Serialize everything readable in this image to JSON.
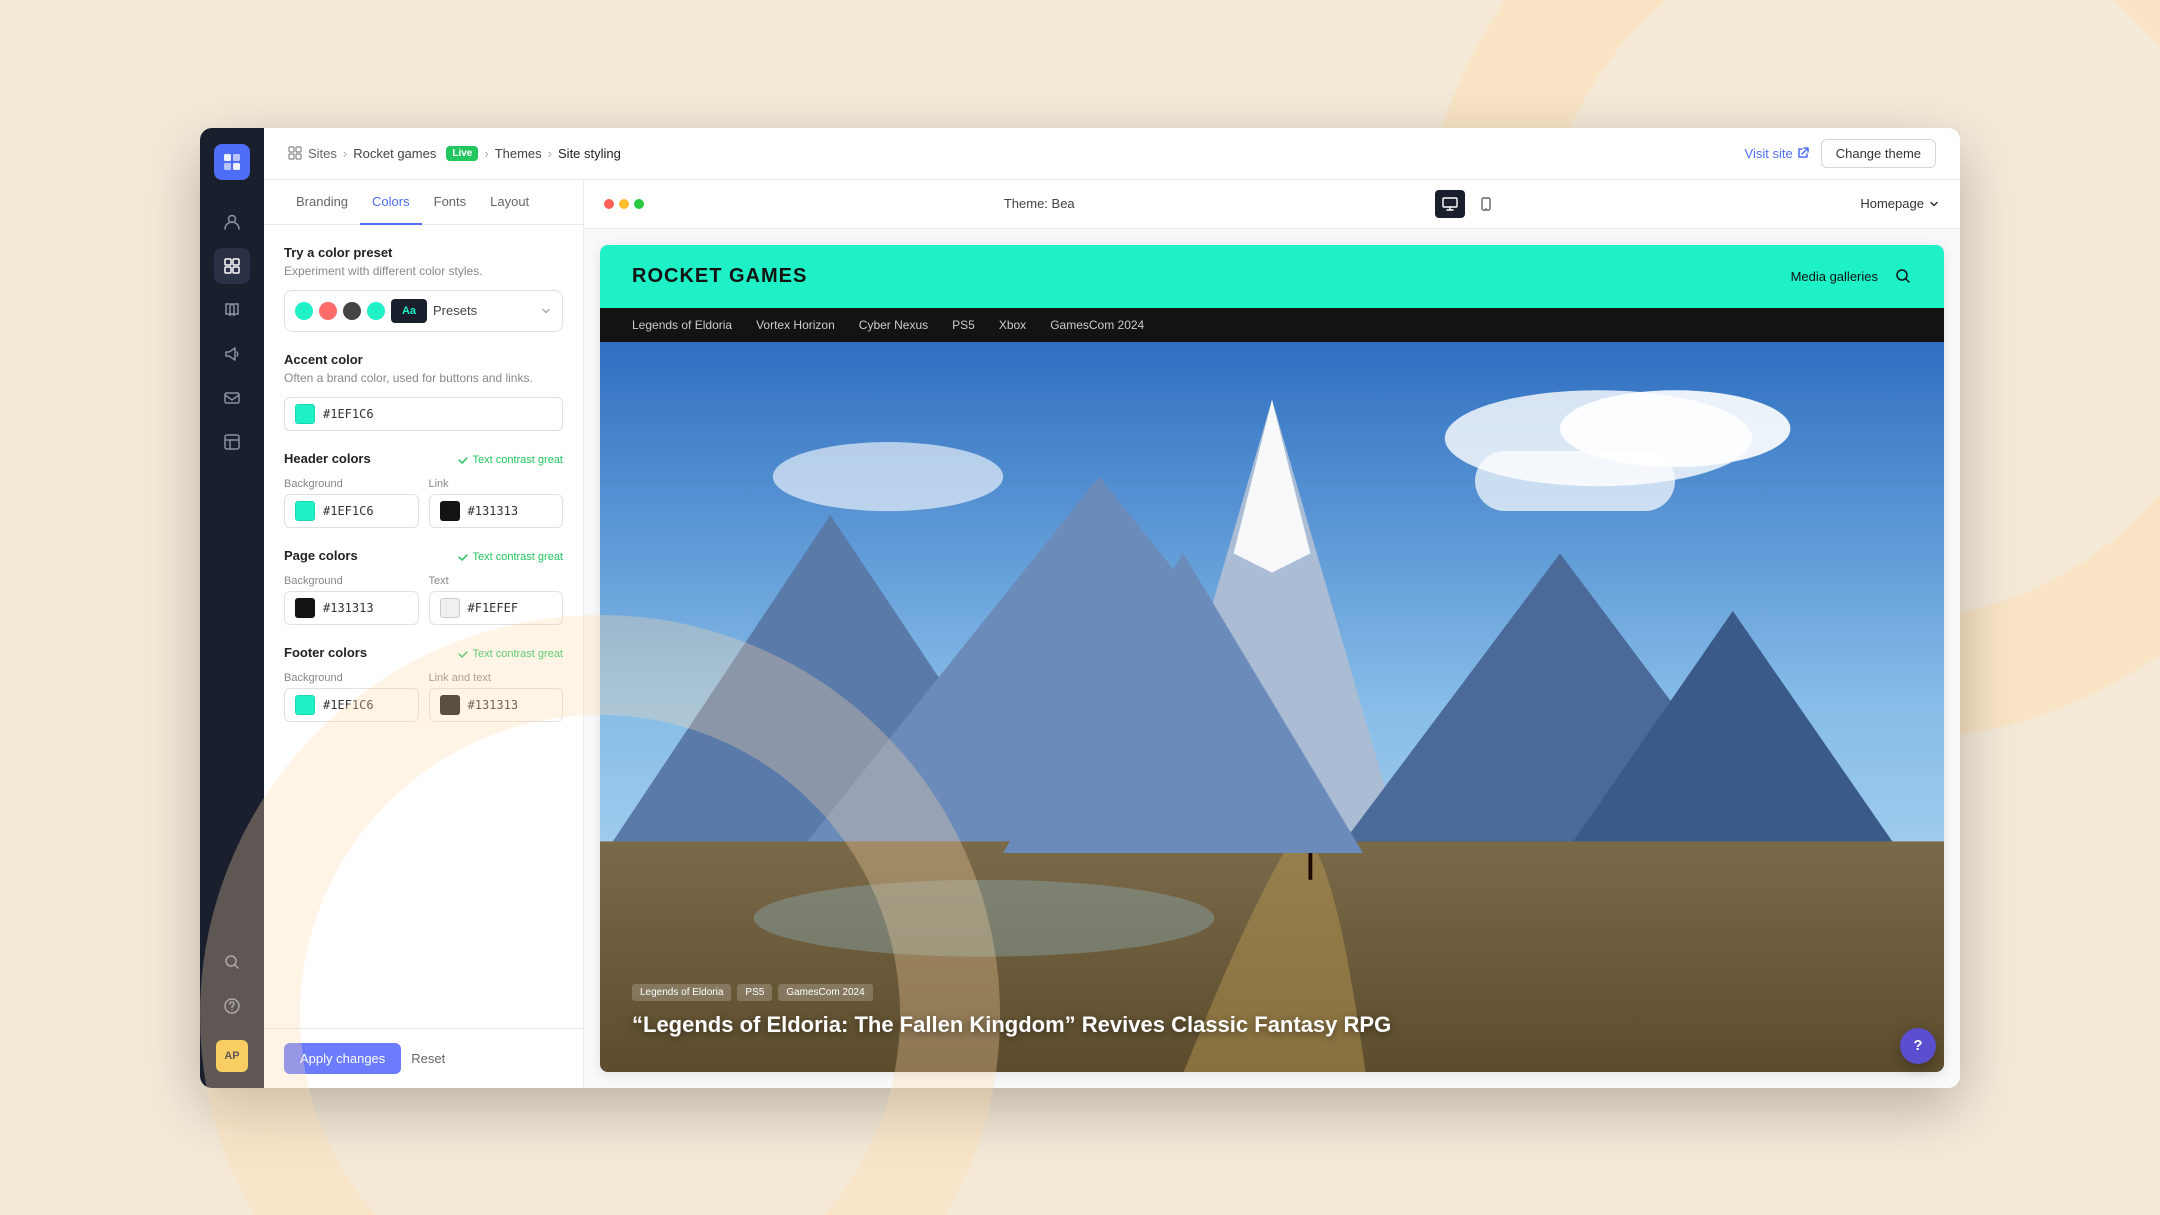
{
  "window": {
    "dots": [
      "#ff5f57",
      "#ffbd2e",
      "#28c840"
    ]
  },
  "sidebar": {
    "logo": "S",
    "icons": [
      {
        "name": "person-icon",
        "symbol": "👤",
        "active": false
      },
      {
        "name": "grid-icon",
        "symbol": "⊞",
        "active": true
      },
      {
        "name": "book-icon",
        "symbol": "📖",
        "active": false
      },
      {
        "name": "megaphone-icon",
        "symbol": "📣",
        "active": false
      },
      {
        "name": "mail-icon",
        "symbol": "✉",
        "active": false
      },
      {
        "name": "widget-icon",
        "symbol": "⊡",
        "active": false
      }
    ],
    "bottom_icons": [
      {
        "name": "search-icon",
        "symbol": "🔍"
      },
      {
        "name": "help-icon",
        "symbol": "?"
      }
    ],
    "avatar": "AP"
  },
  "topbar": {
    "breadcrumb": {
      "sites": "Sites",
      "rocket_games": "Rocket games",
      "live_label": "Live",
      "themes": "Themes",
      "current": "Site styling"
    },
    "visit_site_label": "Visit site",
    "change_theme_label": "Change theme"
  },
  "nav_tabs": {
    "items": [
      {
        "label": "Branding",
        "name": "branding"
      },
      {
        "label": "Colors",
        "name": "colors",
        "active": true
      },
      {
        "label": "Fonts",
        "name": "fonts"
      },
      {
        "label": "Layout",
        "name": "layout"
      }
    ]
  },
  "colors_panel": {
    "preset_section": {
      "title": "Try a color preset",
      "desc": "Experiment with different color styles.",
      "preset_dots": [
        {
          "color": "#1ef1c6"
        },
        {
          "color": "#ff6b6b"
        },
        {
          "color": "#333333"
        },
        {
          "color": "#1ef1c6"
        }
      ],
      "aa_label": "Aa",
      "presets_label": "Presets"
    },
    "accent": {
      "title": "Accent color",
      "desc": "Often a brand color, used for buttons and links.",
      "value": "#1EF1C6"
    },
    "header_colors": {
      "title": "Header colors",
      "contrast_label": "Text contrast great",
      "background_label": "Background",
      "background_value": "#1EF1C6",
      "link_label": "Link",
      "link_value": "#131313"
    },
    "page_colors": {
      "title": "Page colors",
      "contrast_label": "Text contrast great",
      "background_label": "Background",
      "background_value": "#131313",
      "text_label": "Text",
      "text_value": "#F1EFEF"
    },
    "footer_colors": {
      "title": "Footer colors",
      "contrast_label": "Text contrast great",
      "background_label": "Background",
      "background_value": "#1EF1C6",
      "link_text_label": "Link and text",
      "link_text_value": "#131313"
    }
  },
  "footer": {
    "apply_label": "Apply changes",
    "reset_label": "Reset"
  },
  "preview": {
    "theme_label": "Theme: Bea",
    "page_selector": "Homepage",
    "site": {
      "logo": "ROCKET GAMES",
      "header_links": [
        "Media galleries"
      ],
      "nav_items": [
        "Legends of Eldoria",
        "Vortex Horizon",
        "Cyber Nexus",
        "PS5",
        "Xbox",
        "GamesCom 2024"
      ],
      "hero_tags": [
        "Legends of Eldoria",
        "PS5",
        "GamesCom 2024"
      ],
      "hero_title": "“Legends of Eldoria: The Fallen Kingdom” Revives Classic Fantasy RPG"
    }
  }
}
